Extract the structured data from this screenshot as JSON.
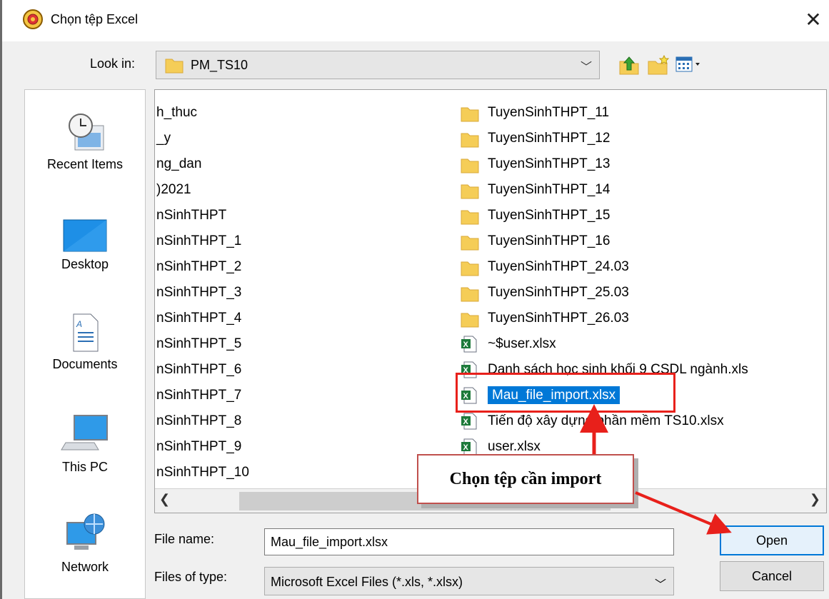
{
  "window": {
    "title": "Chọn tệp Excel"
  },
  "lookin": {
    "label": "Look in:",
    "value": "PM_TS10"
  },
  "places": [
    {
      "label": "Recent Items"
    },
    {
      "label": "Desktop"
    },
    {
      "label": "Documents"
    },
    {
      "label": "This PC"
    },
    {
      "label": "Network"
    }
  ],
  "files_left": [
    "h_thuc",
    "_y",
    "ng_dan",
    ")2021",
    "nSinhTHPT",
    "nSinhTHPT_1",
    "nSinhTHPT_2",
    "nSinhTHPT_3",
    "nSinhTHPT_4",
    "nSinhTHPT_5",
    "nSinhTHPT_6",
    "nSinhTHPT_7",
    "nSinhTHPT_8",
    "nSinhTHPT_9",
    "nSinhTHPT_10"
  ],
  "files_right": [
    {
      "name": "TuyenSinhTHPT_11",
      "icon": "folder-icon"
    },
    {
      "name": "TuyenSinhTHPT_12",
      "icon": "folder-icon"
    },
    {
      "name": "TuyenSinhTHPT_13",
      "icon": "folder-icon"
    },
    {
      "name": "TuyenSinhTHPT_14",
      "icon": "folder-icon"
    },
    {
      "name": "TuyenSinhTHPT_15",
      "icon": "folder-icon"
    },
    {
      "name": "TuyenSinhTHPT_16",
      "icon": "folder-icon"
    },
    {
      "name": "TuyenSinhTHPT_24.03",
      "icon": "folder-icon"
    },
    {
      "name": "TuyenSinhTHPT_25.03",
      "icon": "folder-icon"
    },
    {
      "name": "TuyenSinhTHPT_26.03",
      "icon": "folder-icon"
    },
    {
      "name": "~$user.xlsx",
      "icon": "excel-file-icon"
    },
    {
      "name": "Danh sách học sinh khối 9 CSDL ngành.xls",
      "icon": "excel-file-icon"
    },
    {
      "name": "Mau_file_import.xlsx",
      "icon": "excel-file-icon",
      "selected": true
    },
    {
      "name": "Tiến độ xây dựng phần mềm TS10.xlsx",
      "icon": "excel-file-icon"
    },
    {
      "name": "user.xlsx",
      "icon": "excel-file-icon"
    }
  ],
  "file_name": {
    "label": "File name:",
    "value": "Mau_file_import.xlsx"
  },
  "file_type": {
    "label": "Files of type:",
    "value": "Microsoft Excel Files (*.xls, *.xlsx)"
  },
  "buttons": {
    "open": "Open",
    "cancel": "Cancel"
  },
  "annotation": {
    "text": "Chọn tệp cần import",
    "color": "#e8201b"
  },
  "colors": {
    "selection": "#0078d7",
    "folder": "#f5cd57"
  }
}
